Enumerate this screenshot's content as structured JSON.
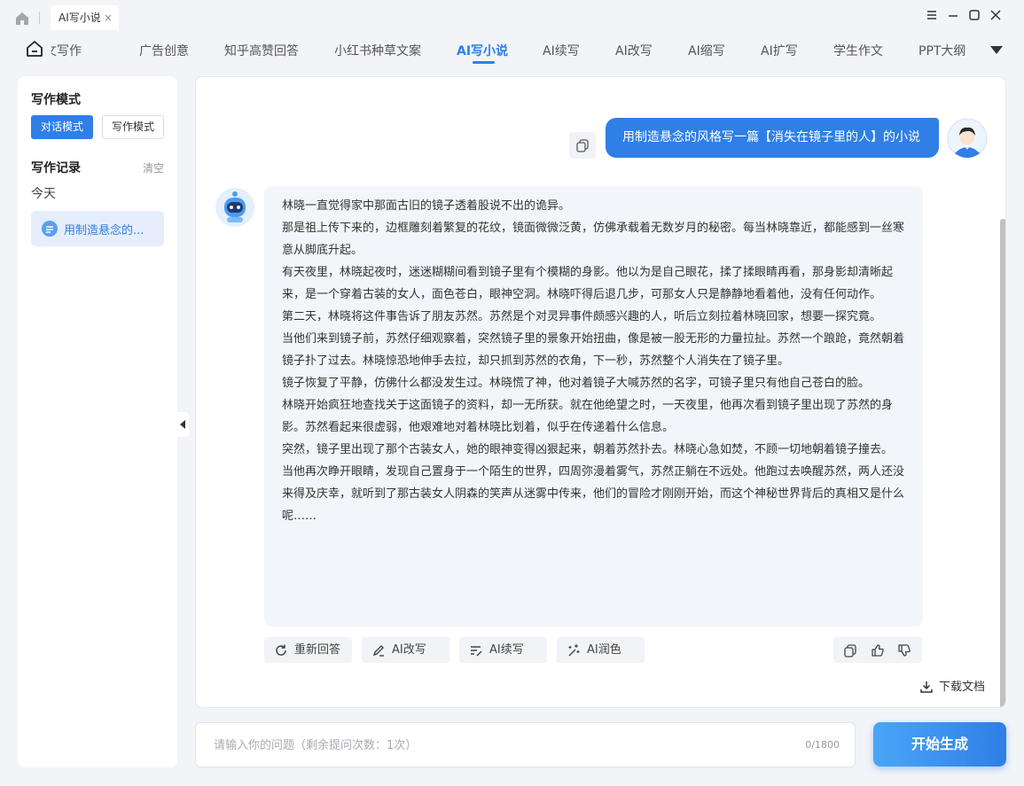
{
  "window": {
    "tab_title": "AI写小说",
    "tab_close": "×"
  },
  "nav": {
    "items": [
      {
        "label": "论文写作"
      },
      {
        "label": "广告创意"
      },
      {
        "label": "知乎高赞回答"
      },
      {
        "label": "小红书种草文案"
      },
      {
        "label": "AI写小说"
      },
      {
        "label": "AI续写"
      },
      {
        "label": "AI改写"
      },
      {
        "label": "AI缩写"
      },
      {
        "label": "AI扩写"
      },
      {
        "label": "学生作文"
      },
      {
        "label": "PPT大纲"
      }
    ],
    "active_index": 4
  },
  "sidebar": {
    "mode_title": "写作模式",
    "mode_chat": "对话模式",
    "mode_write": "写作模式",
    "history_title": "写作记录",
    "clear": "清空",
    "today": "今天",
    "record_label": "用制造悬念的..."
  },
  "chat": {
    "user_message": "用制造悬念的风格写一篇【消失在镜子里的人】的小说",
    "bot_paragraphs": [
      "林晓一直觉得家中那面古旧的镜子透着股说不出的诡异。",
      "那是祖上传下来的，边框雕刻着繁复的花纹，镜面微微泛黄，仿佛承载着无数岁月的秘密。每当林晓靠近，都能感到一丝寒意从脚底升起。",
      "有天夜里，林晓起夜时，迷迷糊糊间看到镜子里有个模糊的身影。他以为是自己眼花，揉了揉眼睛再看，那身影却清晰起来，是一个穿着古装的女人，面色苍白，眼神空洞。林晓吓得后退几步，可那女人只是静静地看着他，没有任何动作。",
      "第二天，林晓将这件事告诉了朋友苏然。苏然是个对灵异事件颇感兴趣的人，听后立刻拉着林晓回家，想要一探究竟。",
      "当他们来到镜子前，苏然仔细观察着，突然镜子里的景象开始扭曲，像是被一股无形的力量拉扯。苏然一个踉跄，竟然朝着镜子扑了过去。林晓惊恐地伸手去拉，却只抓到苏然的衣角，下一秒，苏然整个人消失在了镜子里。",
      "镜子恢复了平静，仿佛什么都没发生过。林晓慌了神，他对着镜子大喊苏然的名字，可镜子里只有他自己苍白的脸。",
      "林晓开始疯狂地查找关于这面镜子的资料，却一无所获。就在他绝望之时，一天夜里，他再次看到镜子里出现了苏然的身影。苏然看起来很虚弱，他艰难地对着林晓比划着，似乎在传递着什么信息。",
      "突然，镜子里出现了那个古装女人，她的眼神变得凶狠起来，朝着苏然扑去。林晓心急如焚，不顾一切地朝着镜子撞去。",
      "当他再次睁开眼睛，发现自己置身于一个陌生的世界，四周弥漫着雾气，苏然正躺在不远处。他跑过去唤醒苏然，两人还没来得及庆幸，就听到了那古装女人阴森的笑声从迷雾中传来，他们的冒险才刚刚开始，而这个神秘世界背后的真相又是什么呢……"
    ],
    "actions": {
      "regenerate": "重新回答",
      "rewrite": "AI改写",
      "continue": "AI续写",
      "polish": "AI润色"
    },
    "download": "下载文档"
  },
  "input": {
    "placeholder": "请输入你的问题（剩余提问次数：1次）",
    "value": "",
    "count": "0/1800"
  },
  "generate_button": "开始生成",
  "colors": {
    "accent": "#2f7fe6",
    "background": "#f2f4f8",
    "bubble_bot": "#f2f5fa"
  }
}
